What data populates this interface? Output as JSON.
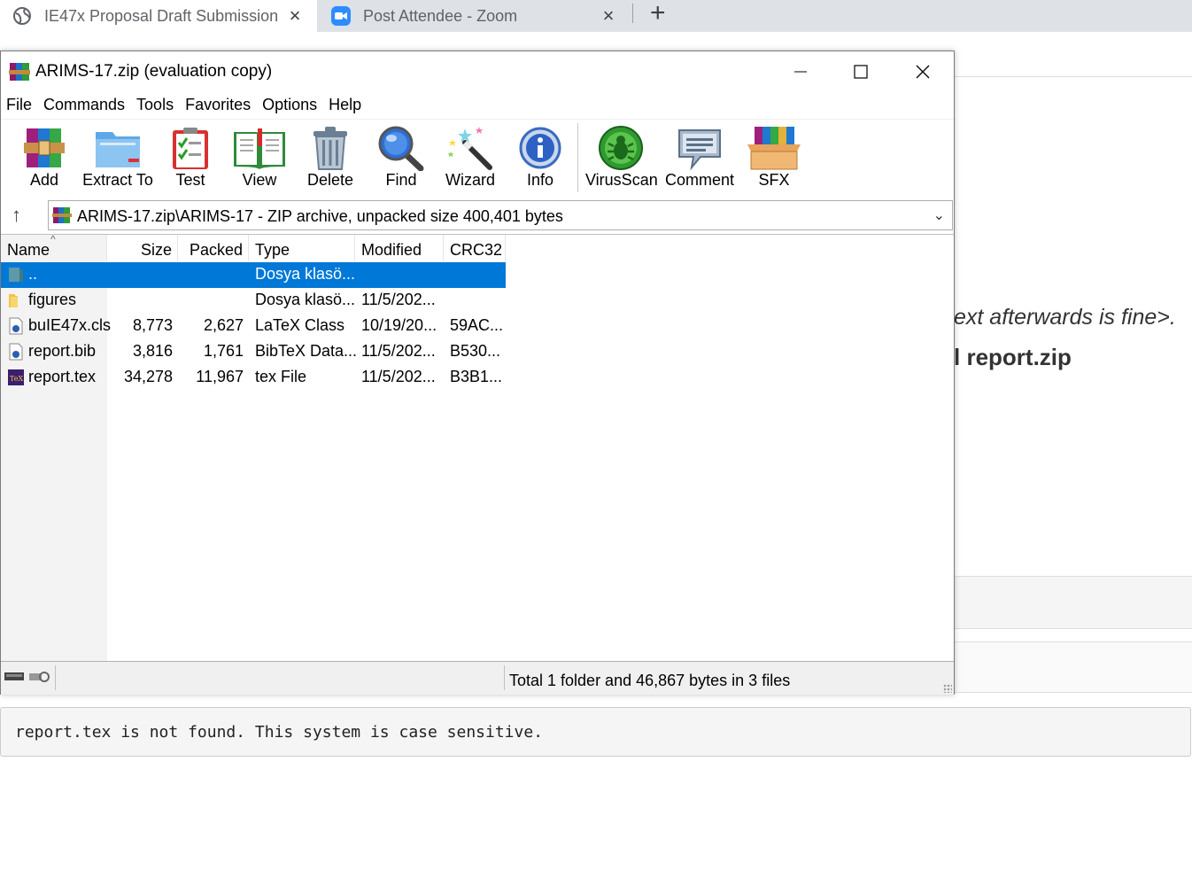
{
  "browser": {
    "tabs": [
      {
        "title": "IE47x Proposal Draft Submission",
        "active": true,
        "close": "×"
      },
      {
        "title": "Post Attendee - Zoom",
        "active": false,
        "close": "×"
      }
    ],
    "new_tab": "+",
    "page_text_1": "ext afterwards is fine>.",
    "page_text_2": "l report.zip",
    "message": "report.tex is not found. This system is case sensitive."
  },
  "winrar": {
    "title": "ARIMS-17.zip (evaluation copy)",
    "menu": [
      "File",
      "Commands",
      "Tools",
      "Favorites",
      "Options",
      "Help"
    ],
    "toolbar": [
      {
        "label": "Add",
        "icon": "add-archive-icon"
      },
      {
        "label": "Extract To",
        "icon": "extract-folder-icon"
      },
      {
        "label": "Test",
        "icon": "test-checklist-icon"
      },
      {
        "label": "View",
        "icon": "view-book-icon"
      },
      {
        "label": "Delete",
        "icon": "trash-icon"
      },
      {
        "label": "Find",
        "icon": "magnifier-icon"
      },
      {
        "label": "Wizard",
        "icon": "magic-wand-icon"
      },
      {
        "label": "Info",
        "icon": "info-icon"
      },
      {
        "label": "VirusScan",
        "icon": "virus-scan-icon"
      },
      {
        "label": "Comment",
        "icon": "comment-icon"
      },
      {
        "label": "SFX",
        "icon": "sfx-box-icon"
      }
    ],
    "path": "ARIMS-17.zip\\ARIMS-17 - ZIP archive, unpacked size 400,401 bytes",
    "columns": [
      "Name",
      "Size",
      "Packed",
      "Type",
      "Modified",
      "CRC32"
    ],
    "files": [
      {
        "name": "..",
        "size": "",
        "packed": "",
        "type": "Dosya klasö...",
        "modified": "",
        "crc": "",
        "icon": "parent-folder-icon",
        "selected": true
      },
      {
        "name": "figures",
        "size": "",
        "packed": "",
        "type": "Dosya klasö...",
        "modified": "11/5/202...",
        "crc": "",
        "icon": "folder-icon",
        "selected": false
      },
      {
        "name": "buIE47x.cls",
        "size": "8,773",
        "packed": "2,627",
        "type": "LaTeX Class",
        "modified": "10/19/20...",
        "crc": "59AC...",
        "icon": "document-icon",
        "selected": false
      },
      {
        "name": "report.bib",
        "size": "3,816",
        "packed": "1,761",
        "type": "BibTeX Data...",
        "modified": "11/5/202...",
        "crc": "B530...",
        "icon": "document-icon",
        "selected": false
      },
      {
        "name": "report.tex",
        "size": "34,278",
        "packed": "11,967",
        "type": "tex File",
        "modified": "11/5/202...",
        "crc": "B3B1...",
        "icon": "tex-file-icon",
        "selected": false
      }
    ],
    "status": "Total 1 folder and 46,867 bytes in 3 files"
  },
  "colors": {
    "selection": "#0078d7",
    "tabstrip": "#dee1e6"
  }
}
